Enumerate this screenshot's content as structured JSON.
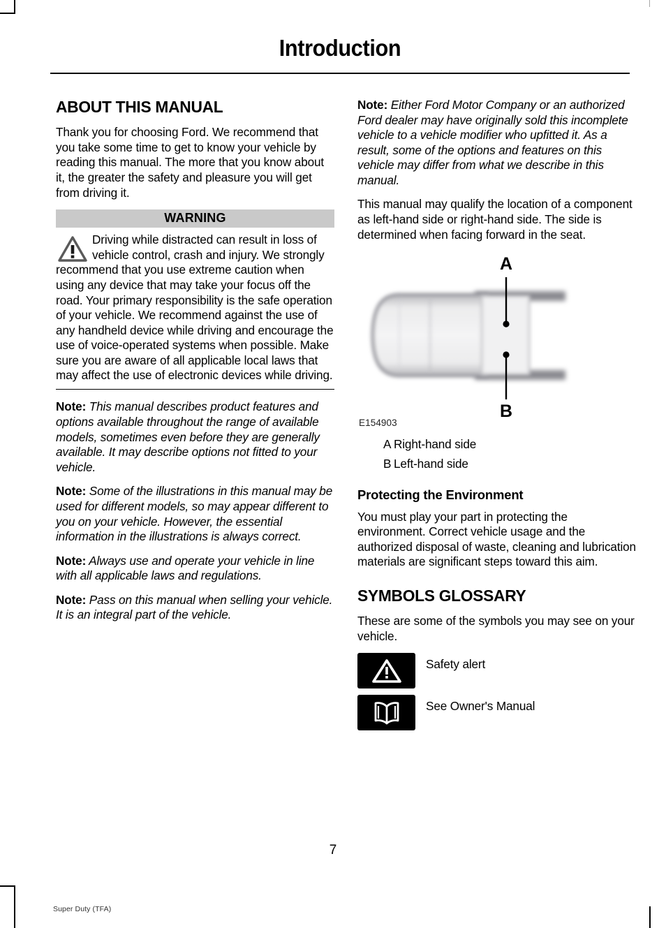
{
  "page": {
    "title": "Introduction",
    "number": "7",
    "footer_note": "Super Duty (TFA)"
  },
  "left_column": {
    "section_heading": "ABOUT THIS MANUAL",
    "intro_paragraph": "Thank you for choosing Ford. We recommend that you take some time to get to know your vehicle by reading this manual. The more that you know about it, the greater the safety and pleasure you will get from driving it.",
    "warning": {
      "bar_label": "WARNING",
      "icon": "warning-triangle-icon",
      "text": "Driving while distracted can result in loss of vehicle control, crash and injury. We strongly recommend that you use extreme caution when using any device that may take your focus off the road. Your primary responsibility is the safe operation of your vehicle. We recommend against the use of any handheld device while driving and encourage the use of voice-operated systems when possible. Make sure you are aware of all applicable local laws that may affect the use of electronic devices while driving."
    },
    "notes": [
      {
        "label": "Note:",
        "text": " This manual describes product features and options available throughout the range of available models, sometimes even before they are generally available. It may describe options not fitted to your vehicle."
      },
      {
        "label": "Note:",
        "text": " Some of the illustrations in this manual may be used for different models, so may appear different to you on your vehicle. However, the essential information in the illustrations is always correct."
      },
      {
        "label": "Note:",
        "text": " Always use and operate your vehicle in line with all applicable laws and regulations."
      },
      {
        "label": "Note:",
        "text": " Pass on this manual when selling your vehicle. It is an integral part of the vehicle."
      }
    ]
  },
  "right_column": {
    "note": {
      "label": "Note:",
      "text": " Either Ford Motor Company or an authorized Ford dealer may have originally sold this incomplete vehicle to a vehicle modifier who upfitted it. As a result, some of the options and features on this vehicle may differ from what we describe in this manual."
    },
    "paragraph": "This manual may qualify the location of a component as left-hand side or right-hand side. The side is determined when facing forward in the seat.",
    "figure": {
      "id": "E154903",
      "callout_top": "A",
      "callout_bottom": "B",
      "description": "vehicle-top-view-illustration"
    },
    "legend": [
      {
        "key": "A",
        "value": "Right-hand side"
      },
      {
        "key": "B",
        "value": "Left-hand side"
      }
    ],
    "environment": {
      "heading": "Protecting the Environment",
      "text": "You must play your part in protecting the environment. Correct vehicle usage and the authorized disposal of waste, cleaning and lubrication materials are significant steps toward this aim."
    },
    "symbols_glossary": {
      "heading": "SYMBOLS GLOSSARY",
      "intro": "These are some of the symbols you may see on your vehicle.",
      "items": [
        {
          "icon": "safety-alert-triangle-icon",
          "label": "Safety alert"
        },
        {
          "icon": "owners-manual-book-icon",
          "label": "See Owner's Manual"
        }
      ]
    }
  },
  "colors": {
    "warning_bar_background": "#c9c9c9",
    "symbol_badge_background": "#000000",
    "text": "#000000"
  }
}
